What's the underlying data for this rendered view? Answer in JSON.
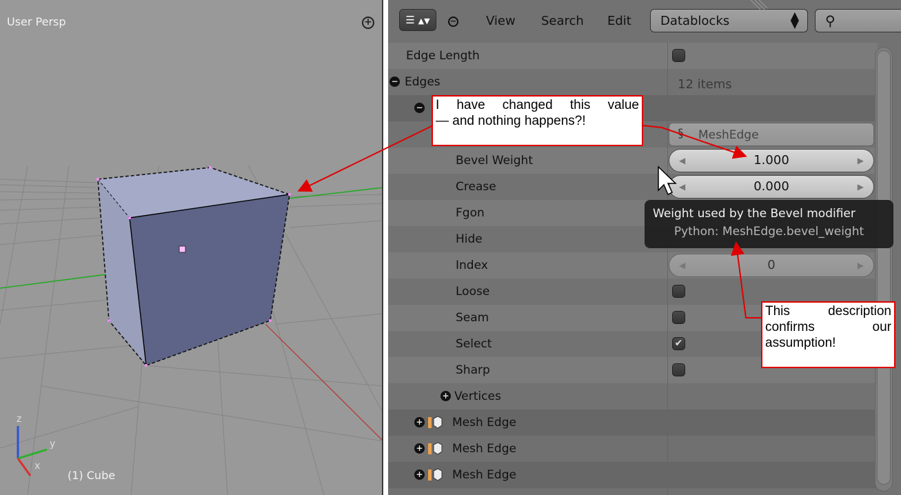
{
  "viewport": {
    "title": "User Persp",
    "object_name": "(1) Cube",
    "axis_labels": {
      "z": "z",
      "y": "y",
      "x": "x"
    }
  },
  "outliner": {
    "header": {
      "editor_type_icon": "outliner-icon",
      "menus": [
        "View",
        "Search",
        "Edit"
      ],
      "display_mode": "Datablocks",
      "search_icon": "magnifier-icon"
    },
    "rows": {
      "edge_length": "Edge Length",
      "edges": "Edges",
      "edges_count": "12 items",
      "mesh_edge_type": "MeshEdge",
      "bevel_weight": "Bevel Weight",
      "bevel_weight_value": "1.000",
      "crease": "Crease",
      "crease_value": "0.000",
      "fgon": "Fgon",
      "hide": "Hide",
      "index": "Index",
      "index_value": "0",
      "loose": "Loose",
      "seam": "Seam",
      "select": "Select",
      "sharp": "Sharp",
      "vertices": "Vertices",
      "mesh_edge_items": [
        "Mesh Edge",
        "Mesh Edge",
        "Mesh Edge"
      ]
    },
    "checkbox_states": {
      "edge_length": false,
      "loose": false,
      "seam": false,
      "select": true,
      "sharp": false
    }
  },
  "tooltip": {
    "title": "Weight used by the Bevel modifier",
    "python": "Python: MeshEdge.bevel_weight"
  },
  "annotations": {
    "top": "I have changed this value — and nothing happens?!",
    "top_line1": "I have changed this value",
    "top_line2": "— and nothing happens?!",
    "bottom_line1": "This description",
    "bottom_line2": "confirms our",
    "bottom_line3": "assumption!"
  },
  "colors": {
    "annotation_red": "#e00000",
    "viewport_bg": "#999999",
    "outliner_bg": "#727272",
    "cube_front": "#5e6488",
    "cube_top": "#a4aac8",
    "cube_side": "#9a9fbb"
  }
}
